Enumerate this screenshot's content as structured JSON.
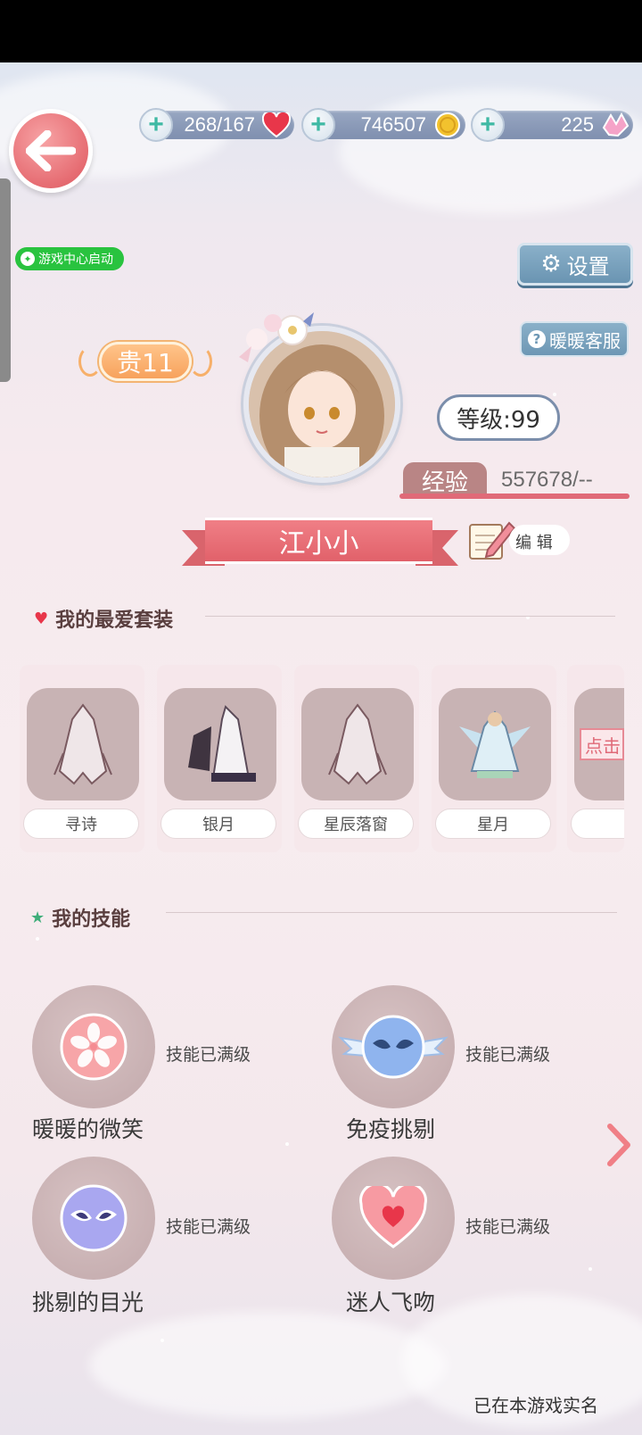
{
  "resources": {
    "stamina": "268/167",
    "coins": "746507",
    "diamonds": "225"
  },
  "game_center_label": "游戏中心启动",
  "settings_label": "设置",
  "service_label": "暖暖客服",
  "vip_label": "贵11",
  "level_label": "等级:99",
  "exp_label": "经验",
  "exp_value": "557678/--",
  "player_name": "江小小",
  "edit_label": "编 辑",
  "favorites": {
    "title": "我的最爱套装",
    "items": [
      {
        "name": "寻诗"
      },
      {
        "name": "银月"
      },
      {
        "name": "星辰落窗"
      },
      {
        "name": "星月"
      }
    ],
    "more_label": "点击"
  },
  "skills": {
    "title": "我的技能",
    "items": [
      {
        "name": "暖暖的微笑",
        "status": "技能已满级",
        "icon": "sakura-icon"
      },
      {
        "name": "免疫挑剔",
        "status": "技能已满级",
        "icon": "winged-mask-icon"
      },
      {
        "name": "挑剔的目光",
        "status": "技能已满级",
        "icon": "mask-icon"
      },
      {
        "name": "迷人飞吻",
        "status": "技能已满级",
        "icon": "heart-icon"
      }
    ]
  },
  "realname_notice": "已在本游戏实名",
  "colors": {
    "accent_pink": "#e1616a",
    "button_blue": "#6a94b2",
    "vip_orange": "#f7a25c",
    "green_badge": "#29c33f"
  }
}
